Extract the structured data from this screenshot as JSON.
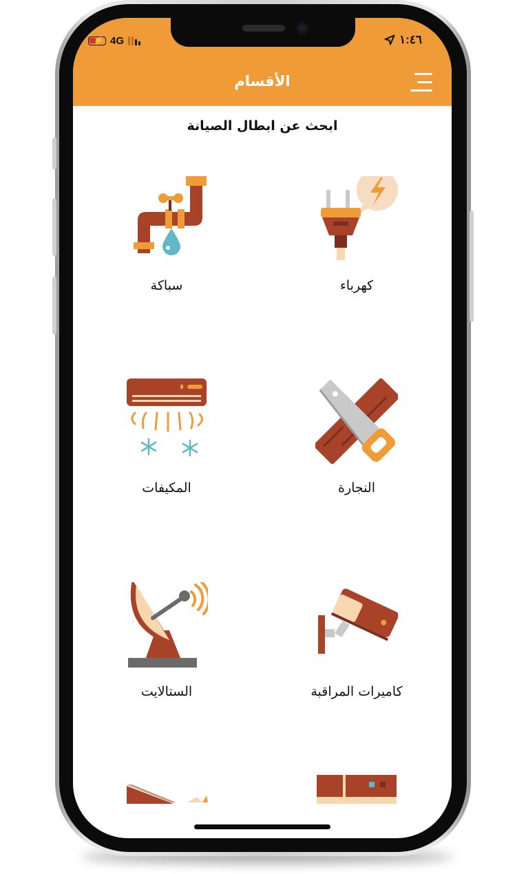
{
  "status_bar": {
    "time": "١:٤٦",
    "network": "4G"
  },
  "header": {
    "title": "الأقسام",
    "background": "#ef9c38"
  },
  "subtitle": "ابحث عن ابطال الصيانة",
  "categories": [
    {
      "label": "كهرباء",
      "icon": "electric-plug-icon"
    },
    {
      "label": "سباكة",
      "icon": "plumbing-pipe-icon"
    },
    {
      "label": "النجارة",
      "icon": "saw-wood-icon"
    },
    {
      "label": "المكيفات",
      "icon": "air-conditioner-icon"
    },
    {
      "label": "كاميرات المراقبة",
      "icon": "security-camera-icon"
    },
    {
      "label": "الستالايت",
      "icon": "satellite-dish-icon"
    }
  ],
  "colors": {
    "accent": "#ef9c38",
    "brick": "#a8432a",
    "dark_brick": "#7a2e1e",
    "teal": "#5fb8c6",
    "cream": "#f6d7b0"
  }
}
